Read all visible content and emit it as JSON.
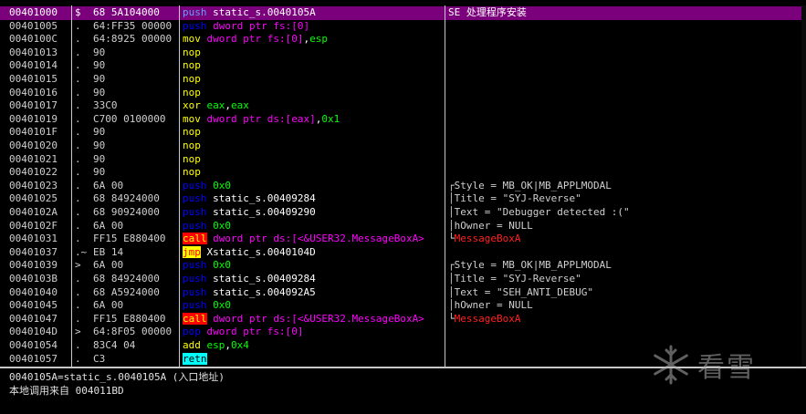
{
  "rows": [
    {
      "addr": "00401000",
      "mark": "$",
      "hex": "68 5A104000",
      "sel": true,
      "dis": [
        [
          "m-push",
          "push"
        ],
        [
          "k-sym",
          " static_s.0040105A"
        ]
      ],
      "com": [
        [
          "",
          "SE 处理程序安装"
        ]
      ]
    },
    {
      "addr": "00401005",
      "mark": ".",
      "hex": "64:FF35 00000",
      "dis": [
        [
          "m-push",
          "push"
        ],
        [
          "k-ptr",
          " dword ptr fs:[0]"
        ]
      ],
      "com": []
    },
    {
      "addr": "0040100C",
      "mark": ".",
      "hex": "64:8925 00000",
      "dis": [
        [
          "m-mov",
          "mov"
        ],
        [
          "k-ptr",
          " dword ptr fs:[0]"
        ],
        [
          "k-rest",
          ","
        ],
        [
          "k-reg",
          "esp"
        ]
      ],
      "com": []
    },
    {
      "addr": "00401013",
      "mark": ".",
      "hex": "90",
      "dis": [
        [
          "m-nop",
          "nop"
        ]
      ],
      "com": []
    },
    {
      "addr": "00401014",
      "mark": ".",
      "hex": "90",
      "dis": [
        [
          "m-nop",
          "nop"
        ]
      ],
      "com": []
    },
    {
      "addr": "00401015",
      "mark": ".",
      "hex": "90",
      "dis": [
        [
          "m-nop",
          "nop"
        ]
      ],
      "com": []
    },
    {
      "addr": "00401016",
      "mark": ".",
      "hex": "90",
      "dis": [
        [
          "m-nop",
          "nop"
        ]
      ],
      "com": []
    },
    {
      "addr": "00401017",
      "mark": ".",
      "hex": "33C0",
      "dis": [
        [
          "m-xor",
          "xor"
        ],
        [
          "k-reg",
          " eax"
        ],
        [
          "k-rest",
          ","
        ],
        [
          "k-reg",
          "eax"
        ]
      ],
      "com": []
    },
    {
      "addr": "00401019",
      "mark": ".",
      "hex": "C700 0100000",
      "dis": [
        [
          "m-mov",
          "mov"
        ],
        [
          "k-ptr",
          " dword ptr ds:[eax]"
        ],
        [
          "k-rest",
          ","
        ],
        [
          "k-num",
          "0x1"
        ]
      ],
      "com": []
    },
    {
      "addr": "0040101F",
      "mark": ".",
      "hex": "90",
      "dis": [
        [
          "m-nop",
          "nop"
        ]
      ],
      "com": []
    },
    {
      "addr": "00401020",
      "mark": ".",
      "hex": "90",
      "dis": [
        [
          "m-nop",
          "nop"
        ]
      ],
      "com": []
    },
    {
      "addr": "00401021",
      "mark": ".",
      "hex": "90",
      "dis": [
        [
          "m-nop",
          "nop"
        ]
      ],
      "com": []
    },
    {
      "addr": "00401022",
      "mark": ".",
      "hex": "90",
      "dis": [
        [
          "m-nop",
          "nop"
        ]
      ],
      "com": []
    },
    {
      "addr": "00401023",
      "mark": ".",
      "hex": "6A 00",
      "dis": [
        [
          "m-push",
          "push"
        ],
        [
          "k-num",
          " 0x0"
        ]
      ],
      "com": [
        [
          "bracket",
          "┌"
        ],
        [
          "",
          "Style = MB_OK|MB_APPLMODAL"
        ]
      ]
    },
    {
      "addr": "00401025",
      "mark": ".",
      "hex": "68 84924000",
      "dis": [
        [
          "m-push",
          "push"
        ],
        [
          "k-sym",
          " static_s.00409284"
        ]
      ],
      "com": [
        [
          "bracket",
          "│"
        ],
        [
          "",
          "Title = \"SYJ-Reverse\""
        ]
      ]
    },
    {
      "addr": "0040102A",
      "mark": ".",
      "hex": "68 90924000",
      "dis": [
        [
          "m-push",
          "push"
        ],
        [
          "k-sym",
          " static_s.00409290"
        ]
      ],
      "com": [
        [
          "bracket",
          "│"
        ],
        [
          "",
          "Text = \"Debugger detected :(\""
        ]
      ]
    },
    {
      "addr": "0040102F",
      "mark": ".",
      "hex": "6A 00",
      "dis": [
        [
          "m-push",
          "push"
        ],
        [
          "k-num",
          " 0x0"
        ]
      ],
      "com": [
        [
          "bracket",
          "│"
        ],
        [
          "",
          "hOwner = NULL"
        ]
      ]
    },
    {
      "addr": "00401031",
      "mark": ".",
      "hex": "FF15 E880400",
      "dis": [
        [
          "m-call",
          "call"
        ],
        [
          "k-mem",
          " dword ptr ds:[<&USER32.MessageBoxA>"
        ]
      ],
      "com": [
        [
          "bracket",
          "└"
        ],
        [
          "red",
          "MessageBoxA"
        ]
      ]
    },
    {
      "addr": "00401037",
      "mark": ".~",
      "hex": "EB 14",
      "dis": [
        [
          "m-jmp",
          "jmp"
        ],
        [
          "k-sym",
          " Xstatic_s.0040104D"
        ]
      ],
      "com": []
    },
    {
      "addr": "00401039",
      "mark": "&gt;",
      "hex": "6A 00",
      "dis": [
        [
          "m-push",
          "push"
        ],
        [
          "k-num",
          " 0x0"
        ]
      ],
      "com": [
        [
          "bracket",
          "┌"
        ],
        [
          "",
          "Style = MB_OK|MB_APPLMODAL"
        ]
      ]
    },
    {
      "addr": "0040103B",
      "mark": ".",
      "hex": "68 84924000",
      "dis": [
        [
          "m-push",
          "push"
        ],
        [
          "k-sym",
          " static_s.00409284"
        ]
      ],
      "com": [
        [
          "bracket",
          "│"
        ],
        [
          "",
          "Title = \"SYJ-Reverse\""
        ]
      ]
    },
    {
      "addr": "00401040",
      "mark": ".",
      "hex": "68 A5924000",
      "dis": [
        [
          "m-push",
          "push"
        ],
        [
          "k-sym",
          " static_s.004092A5"
        ]
      ],
      "com": [
        [
          "bracket",
          "│"
        ],
        [
          "",
          "Text = \"SEH_ANTI_DEBUG\""
        ]
      ]
    },
    {
      "addr": "00401045",
      "mark": ".",
      "hex": "6A 00",
      "dis": [
        [
          "m-push",
          "push"
        ],
        [
          "k-num",
          " 0x0"
        ]
      ],
      "com": [
        [
          "bracket",
          "│"
        ],
        [
          "",
          "hOwner = NULL"
        ]
      ]
    },
    {
      "addr": "00401047",
      "mark": ".",
      "hex": "FF15 E880400",
      "dis": [
        [
          "m-call",
          "call"
        ],
        [
          "k-mem",
          " dword ptr ds:[<&USER32.MessageBoxA>"
        ]
      ],
      "com": [
        [
          "bracket",
          "└"
        ],
        [
          "red",
          "MessageBoxA"
        ]
      ]
    },
    {
      "addr": "0040104D",
      "mark": "&gt;",
      "hex": "64:8F05 00000",
      "dis": [
        [
          "m-pop",
          "pop"
        ],
        [
          "k-ptr",
          " dword ptr fs:[0]"
        ]
      ],
      "com": []
    },
    {
      "addr": "00401054",
      "mark": ".",
      "hex": "83C4 04",
      "dis": [
        [
          "m-add",
          "add"
        ],
        [
          "k-reg",
          " esp"
        ],
        [
          "k-rest",
          ","
        ],
        [
          "k-num",
          "0x4"
        ]
      ],
      "com": []
    },
    {
      "addr": "00401057",
      "mark": ".",
      "hex": "C3",
      "dis": [
        [
          "m-retn",
          "retn"
        ]
      ],
      "com": []
    }
  ],
  "info": {
    "line1": "0040105A=static_s.0040105A (入口地址)",
    "line2": "本地调用来自 004011BD"
  },
  "watermark": {
    "text": "看雪",
    "icon": "snowflake-icon",
    "color": "#b0b0b0"
  },
  "colors": {
    "selection": "#7b007b",
    "push": "#0000ff",
    "instr": "#ffff00",
    "call_bg": "#ff0000",
    "jmp_bg": "#ffff00",
    "retn_bg": "#00ffff",
    "operand_mem": "#ff00ff",
    "operand_reg": "#00ff00"
  }
}
